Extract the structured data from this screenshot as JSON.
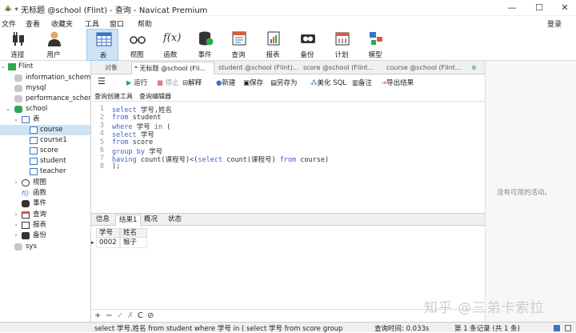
{
  "window": {
    "title": "* 无标题 @school (Flint) - 查询 - Navicat Premium",
    "controls": [
      "—",
      "☐",
      "✕"
    ]
  },
  "menu": [
    "文件",
    "查看",
    "收藏夹",
    "工具",
    "窗口",
    "帮助"
  ],
  "login": "登录",
  "ribbon": [
    {
      "label": "连接",
      "icon": "connection-icon"
    },
    {
      "label": "用户",
      "icon": "user-icon"
    },
    {
      "label": "表",
      "icon": "table-icon",
      "selected": true
    },
    {
      "label": "视图",
      "icon": "view-icon"
    },
    {
      "label": "函数",
      "icon": "function-icon"
    },
    {
      "label": "事件",
      "icon": "event-icon"
    },
    {
      "label": "查询",
      "icon": "query-icon"
    },
    {
      "label": "报表",
      "icon": "report-icon"
    },
    {
      "label": "备份",
      "icon": "backup-icon"
    },
    {
      "label": "计划",
      "icon": "schedule-icon"
    },
    {
      "label": "模型",
      "icon": "model-icon"
    }
  ],
  "tree": {
    "root": "Flint",
    "dbs": [
      "information_schema",
      "mysql",
      "performance_schema"
    ],
    "school": "school",
    "tables_group": "表",
    "tables": [
      "course",
      "course1",
      "score",
      "student",
      "teacher"
    ],
    "groups": [
      "视图",
      "函数",
      "事件",
      "查询",
      "报表",
      "备份"
    ],
    "sys": "sys"
  },
  "tabs": {
    "objects": "对象",
    "t1": "* 无标题 @school (Fli...",
    "t2": "student @school (Flint)...",
    "t3": "score @school (Flint...",
    "t4": "course @school (Flint..."
  },
  "toolbar": {
    "run": "运行",
    "stop": "停止",
    "explain": "解释",
    "new": "新建",
    "save": "保存",
    "save_as": "另存为",
    "beautify": "美化 SQL",
    "note": "备注",
    "export": "导出结果"
  },
  "subtabs": {
    "builder": "查询创建工具",
    "editor": "查询编辑器"
  },
  "code": {
    "numbers": [
      "1",
      "2",
      "3",
      "4",
      "5",
      "6",
      "7",
      "8"
    ],
    "l1a": "select",
    "l1b": " 学号,姓名",
    "l2a": "from",
    "l2b": " student",
    "l3a": "where",
    "l3b": " 学号 ",
    "l3c": "in",
    "l3d": " (",
    "l4a": "select",
    "l4b": " 学号",
    "l5a": "from",
    "l5b": " score",
    "l6a": "group by",
    "l6b": " 学号",
    "l7a": "having",
    "l7b": " count(课程号)<(",
    "l7c": "select",
    "l7d": " count(课程号) ",
    "l7e": "from",
    "l7f": " course)",
    "l8": ");"
  },
  "result_tabs": [
    "信息",
    "结果1",
    "概况",
    "状态"
  ],
  "grid": {
    "columns": [
      "学号",
      "姓名"
    ],
    "rows": [
      [
        "0002",
        "猴子"
      ]
    ]
  },
  "grid_tools": [
    "+",
    "−",
    "✓",
    "✗",
    "C",
    "⊘"
  ],
  "right_panel": {
    "no_activity": "没有可用的活动。"
  },
  "watermark": "知乎 @三弟卡索拉",
  "status": {
    "sql": "select 学号,姓名 from student  where 学号 in ( select 学号 from score group",
    "time": "查询时间: 0.033s",
    "records": "第 1 条记录 (共 1 条)"
  },
  "colors": {
    "accent": "#cde4f7",
    "keyword": "#3d64c8",
    "run_green": "#2fa84f"
  }
}
